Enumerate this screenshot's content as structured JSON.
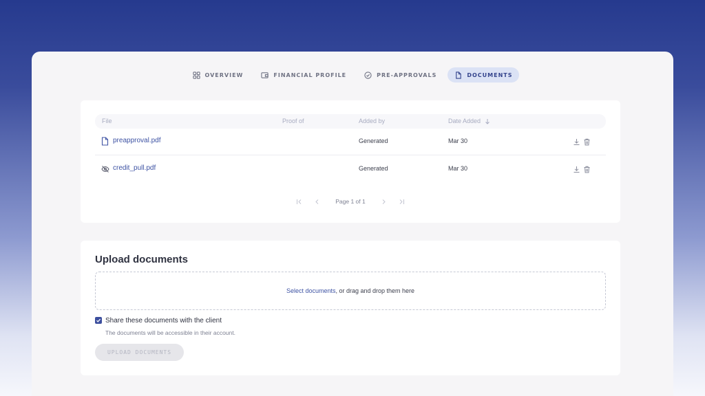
{
  "tabs": [
    {
      "label": "OVERVIEW",
      "icon": "grid-icon"
    },
    {
      "label": "FINANCIAL PROFILE",
      "icon": "wallet-icon"
    },
    {
      "label": "PRE-APPROVALS",
      "icon": "check-circle-icon"
    },
    {
      "label": "DOCUMENTS",
      "icon": "document-icon",
      "active": true
    }
  ],
  "table": {
    "headers": {
      "file": "File",
      "proof_of": "Proof of",
      "added_by": "Added by",
      "date_added": "Date Added"
    },
    "sort_icon": "arrow-down-icon",
    "rows": [
      {
        "file": "preapproval.pdf",
        "icon": "document-icon",
        "proof_of": "",
        "added_by": "Generated",
        "date": "Mar 30"
      },
      {
        "file": "credit_pull.pdf",
        "icon": "eye-off-icon",
        "proof_of": "",
        "added_by": "Generated",
        "date": "Mar 30"
      }
    ]
  },
  "pagination": {
    "label": "Page 1 of 1"
  },
  "upload": {
    "title": "Upload documents",
    "select_link": "Select documents",
    "drop_text": ", or drag and drop them here",
    "share_label": "Share these documents with the client",
    "share_checked": true,
    "share_sub": "The documents will be accessible in their account.",
    "button": "UPLOAD DOCUMENTS"
  },
  "colors": {
    "accent": "#3d52a3",
    "active_tab_bg": "#dbe2f5"
  }
}
